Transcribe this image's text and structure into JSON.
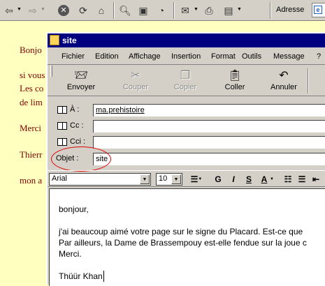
{
  "browser": {
    "address_label": "Adresse",
    "toolbar_icons": [
      "back-icon",
      "forward-icon",
      "stop-icon",
      "refresh-icon",
      "home-icon",
      "search-icon",
      "favorites-icon",
      "history-icon",
      "mail-icon",
      "print-icon",
      "edit-icon"
    ]
  },
  "page_text": {
    "line1": "Bonjo",
    "line2": "si vous",
    "line3": "Les co",
    "line4": "de lim",
    "line5": "Merci",
    "line6": "Thierr",
    "line7": "mon a"
  },
  "window": {
    "title": "site",
    "menu": [
      "Fichier",
      "Edition",
      "Affichage",
      "Insertion",
      "Format",
      "Outils",
      "Message",
      "?"
    ],
    "toolbar": {
      "send": "Envoyer",
      "cut": "Couper",
      "copy": "Copier",
      "paste": "Coller",
      "undo": "Annuler"
    },
    "fields": {
      "to_label": "À :",
      "to_value": "ma.prehistoire",
      "cc_label": "Cc :",
      "cc_value": "",
      "bcc_label": "Cci :",
      "bcc_value": "",
      "subject_label": "Objet :",
      "subject_value": "site"
    },
    "format": {
      "font": "Arial",
      "size": "10",
      "bold": "G",
      "italic": "I",
      "underline": "S",
      "color": "A"
    },
    "body": {
      "l1": "bonjour,",
      "l2": "j'ai beaucoup aimé votre page sur le signe du Placard. Est-ce que",
      "l3": "Par ailleurs, la Dame de Brassempouy est-elle fendue sur la joue c",
      "l4": "Merci.",
      "l5": "Thüür Khan"
    }
  },
  "colors": {
    "titlebar": "#000080",
    "page_bg": "#ffffc0",
    "page_text": "#800000",
    "annotation": "#e00000"
  }
}
